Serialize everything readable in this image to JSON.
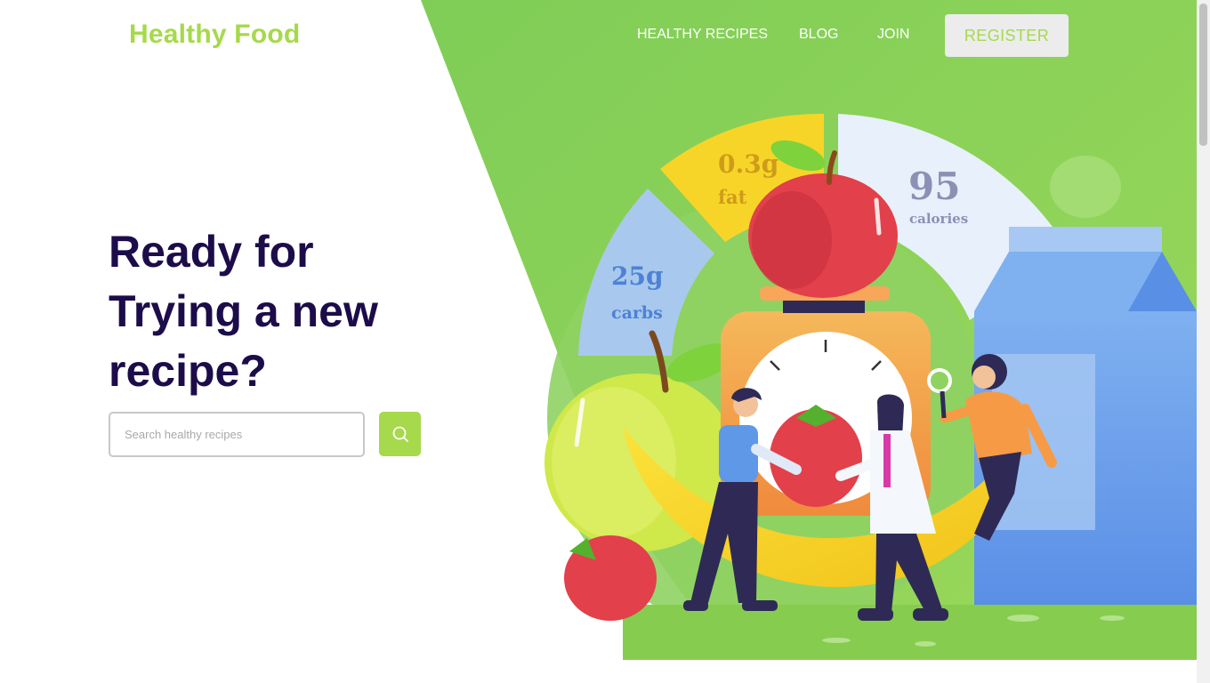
{
  "header": {
    "logo": "Healthy Food",
    "nav": [
      {
        "label": "HEALTHY RECIPES"
      },
      {
        "label": "BLOG"
      },
      {
        "label": "JOIN"
      }
    ],
    "register_label": "REGISTER"
  },
  "hero": {
    "title_line1": "Ready for",
    "title_line2": "Trying a new",
    "title_line3": "recipe?",
    "search_placeholder": "Search healthy recipes",
    "search_icon": "search-icon"
  },
  "nutrition": {
    "fat_value": "0.3g",
    "fat_label": "fat",
    "carbs_value": "25g",
    "carbs_label": "carbs",
    "calories_value": "95",
    "calories_label": "calories"
  },
  "colors": {
    "brand_green": "#a6d94b",
    "title_dark": "#1d0c4a",
    "nav_text": "#ffffff"
  }
}
